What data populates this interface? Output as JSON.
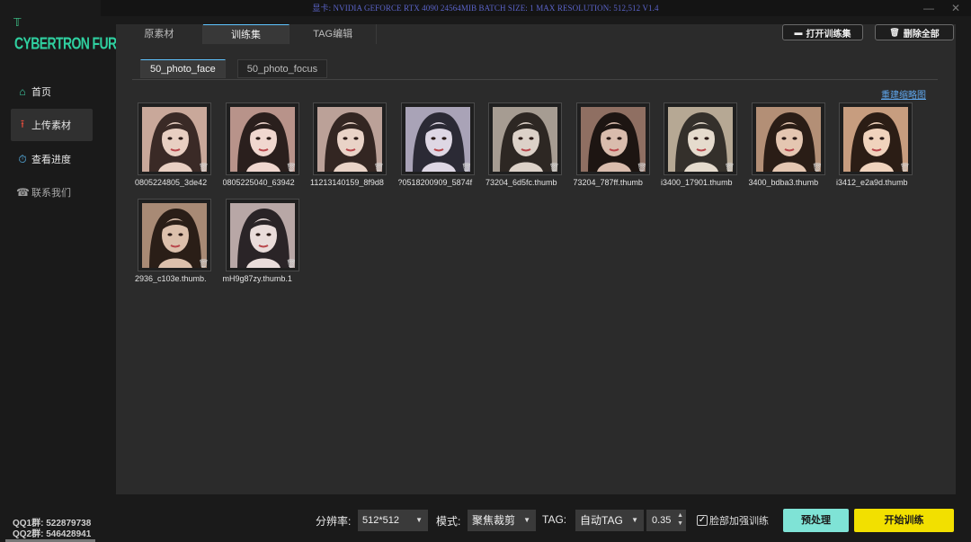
{
  "titlebar": {
    "info": "显卡: NVIDIA GEFORCE RTX 4090 24564MIB  BATCH SIZE: 1  MAX RESOLUTION: 512,512 V1.4",
    "minimize": "—",
    "close": "✕"
  },
  "logo": {
    "text": "CYBERTRON FURNACE"
  },
  "nav": [
    {
      "label": "首页",
      "icon": "home-icon"
    },
    {
      "label": "上传素材",
      "icon": "upload-icon"
    },
    {
      "label": "查看进度",
      "icon": "progress-icon"
    },
    {
      "label": "联系我们",
      "icon": "contact-icon"
    }
  ],
  "qq": {
    "line1": "QQ1群: 522879738",
    "line2": "QQ2群: 546428941"
  },
  "tabs": [
    "原素材",
    "训练集",
    "TAG编辑"
  ],
  "buttons": {
    "open_set": "打开训练集",
    "delete_all": "删除全部"
  },
  "subtabs": [
    "50_photo_face",
    "50_photo_focus"
  ],
  "rebuild_link": "重建缩略图",
  "thumbnails": [
    "0805224805_3de42",
    "0805225040_63942",
    "11213140159_8f9d8",
    "?0518200909_5874f",
    "73204_6d5fc.thumb",
    "73204_787ff.thumb",
    "i3400_17901.thumb",
    "3400_bdba3.thumb",
    "i3412_e2a9d.thumb",
    "2936_c103e.thumb.",
    "mH9g87zy.thumb.1"
  ],
  "bottom": {
    "resolution_label": "分辨率:",
    "resolution_value": "512*512",
    "mode_label": "模式:",
    "mode_value": "聚焦裁剪",
    "tag_label": "TAG:",
    "tag_value": "自动TAG",
    "threshold": "0.35",
    "face_enhance_label": "脸部加强训练",
    "face_enhance_checked": "✓",
    "preprocess": "预处理",
    "start_training": "开始训练"
  },
  "colors": {
    "accent": "#5fc4ff",
    "logo": "#2fd0a0",
    "preprocess_btn": "#7fe3d6",
    "start_btn": "#f2e000",
    "upload_icon": "#e24c3c"
  }
}
